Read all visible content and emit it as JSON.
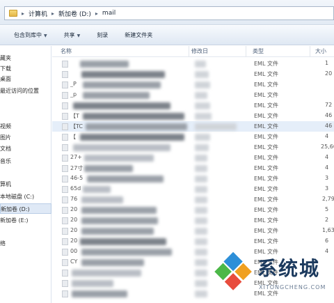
{
  "address": {
    "crumbs": [
      "计算机",
      "新加卷 (D:)",
      "mail"
    ],
    "separator": "▸"
  },
  "toolbar": {
    "include_label": "包含到库中",
    "share_label": "共享",
    "burn_label": "刻录",
    "new_folder_label": "新建文件夹"
  },
  "nav": {
    "items": [
      "藏夹",
      "下载",
      "桌面",
      "最近访问的位置",
      "",
      "视频",
      "图片",
      "文档",
      "音乐",
      "",
      "算机",
      "本地磁盘 (C:)",
      "新加卷 (D:)",
      "新加卷 (E:)",
      "",
      "络"
    ]
  },
  "columns": {
    "name": "名称",
    "date": "修改日",
    "type": "类型",
    "size": "大小"
  },
  "rows": [
    {
      "name": "",
      "type": "EML 文件",
      "size": "1"
    },
    {
      "name": "",
      "type": "EML 文件",
      "size": "20"
    },
    {
      "name": "_P",
      "type": "EML 文件",
      "size": ""
    },
    {
      "name": "_p",
      "type": "EML 文件",
      "size": ""
    },
    {
      "name": "",
      "type": "EML 文件",
      "size": "72"
    },
    {
      "name": "【T",
      "type": "EML 文件",
      "size": "46"
    },
    {
      "name": "【TC",
      "type": "EML 文件",
      "size": "46"
    },
    {
      "name": "【",
      "type": "EML 文件",
      "size": "4"
    },
    {
      "name": "",
      "type": "EML 文件",
      "size": "25,60"
    },
    {
      "name": "27+",
      "type": "EML 文件",
      "size": "4"
    },
    {
      "name": "27寸",
      "type": "EML 文件",
      "size": "4"
    },
    {
      "name": "46-5",
      "type": "EML 文件",
      "size": "3"
    },
    {
      "name": "65d",
      "type": "EML 文件",
      "size": "3"
    },
    {
      "name": "76",
      "type": "EML 文件",
      "size": "2,79"
    },
    {
      "name": "20",
      "type": "EML 文件",
      "size": "5"
    },
    {
      "name": "20",
      "type": "EML 文件",
      "size": "2"
    },
    {
      "name": "20",
      "type": "EML 文件",
      "size": "1,63"
    },
    {
      "name": "20",
      "type": "EML 文件",
      "size": "6"
    },
    {
      "name": "00",
      "type": "EML 文件",
      "size": "4"
    },
    {
      "name": "CY",
      "type": "EML 文件",
      "size": ""
    },
    {
      "name": "",
      "type": "EML 文件",
      "size": ""
    },
    {
      "name": "",
      "type": "EML 文件",
      "size": ""
    },
    {
      "name": "",
      "type": "EML 文件",
      "size": ""
    }
  ],
  "watermark": {
    "title": "系统城",
    "subtitle": "XITONGCHENG.COM",
    "colors": [
      "#2d8fd8",
      "#4cb848",
      "#f0a020",
      "#e84c3d"
    ]
  }
}
